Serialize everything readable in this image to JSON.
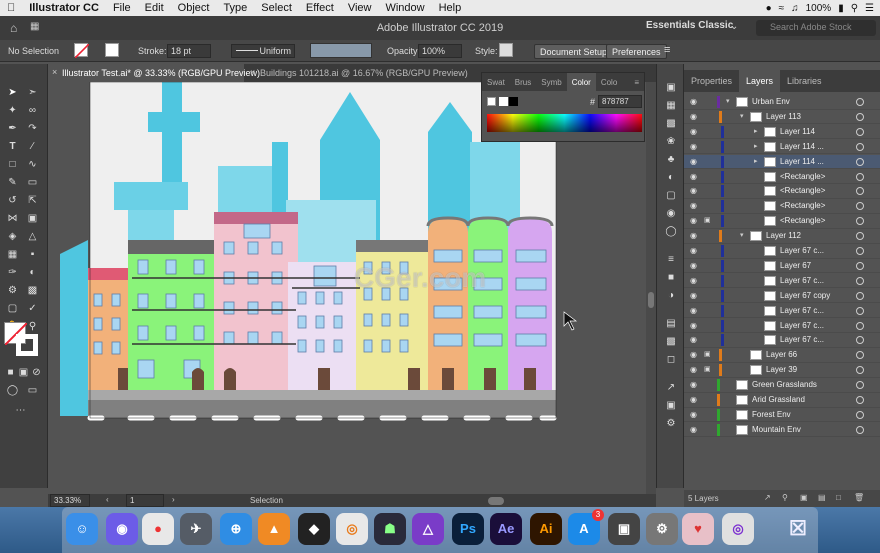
{
  "menubar": {
    "app": "Illustrator CC",
    "items": [
      "File",
      "Edit",
      "Object",
      "Type",
      "Select",
      "Effect",
      "View",
      "Window",
      "Help"
    ],
    "battery": "100%",
    "apple": ""
  },
  "appbar": {
    "title": "Adobe Illustrator CC 2019",
    "workspace": "Essentials Classic",
    "search_placeholder": "Search Adobe Stock"
  },
  "controlbar": {
    "selection": "No Selection",
    "stroke_label": "Stroke:",
    "stroke_value": "18 pt",
    "profile": "Uniform",
    "opacity_label": "Opacity:",
    "opacity_value": "100%",
    "style_label": "Style:",
    "doc_setup": "Document Setup",
    "preferences": "Preferences"
  },
  "tabs": [
    {
      "label": "Illustrator Test.ai* @ 33.33% (RGB/GPU Preview)"
    },
    {
      "label": "Buildings 101218.ai @ 16.67% (RGB/GPU Preview)"
    }
  ],
  "color_panel": {
    "tabs": [
      "Swat",
      "Brus",
      "Symb",
      "Color",
      "Colo"
    ],
    "hex": "878787"
  },
  "status": {
    "zoom": "33.33%",
    "artboard": "1",
    "mode": "Selection"
  },
  "layers_panel": {
    "tabs": [
      "Properties",
      "Layers",
      "Libraries"
    ],
    "count": "5 Layers",
    "rows": [
      {
        "name": "Urban Env",
        "indent": 0,
        "color": "#6a2ca0",
        "expanded": true
      },
      {
        "name": "Layer 113",
        "indent": 1,
        "color": "#e07b1a",
        "expanded": true
      },
      {
        "name": "Layer 114",
        "indent": 2,
        "color": "#1f2f9a",
        "expanded": false
      },
      {
        "name": "Layer 114 ...",
        "indent": 2,
        "color": "#1f2f9a",
        "expanded": false
      },
      {
        "name": "Layer 114 ...",
        "indent": 2,
        "color": "#1f2f9a",
        "expanded": false,
        "selected": true
      },
      {
        "name": "<Rectangle>",
        "indent": 2,
        "color": "#1f2f9a"
      },
      {
        "name": "<Rectangle>",
        "indent": 2,
        "color": "#1f2f9a"
      },
      {
        "name": "<Rectangle>",
        "indent": 2,
        "color": "#1f2f9a"
      },
      {
        "name": "<Rectangle>",
        "indent": 2,
        "color": "#1f2f9a",
        "locked": true
      },
      {
        "name": "Layer 112",
        "indent": 1,
        "color": "#e07b1a",
        "expanded": true
      },
      {
        "name": "Layer 67 c...",
        "indent": 2,
        "color": "#1f2f9a"
      },
      {
        "name": "Layer 67",
        "indent": 2,
        "color": "#1f2f9a"
      },
      {
        "name": "Layer 67 c...",
        "indent": 2,
        "color": "#1f2f9a"
      },
      {
        "name": "Layer 67 copy",
        "indent": 2,
        "color": "#1f2f9a"
      },
      {
        "name": "Layer 67 c...",
        "indent": 2,
        "color": "#1f2f9a"
      },
      {
        "name": "Layer 67 c...",
        "indent": 2,
        "color": "#1f2f9a"
      },
      {
        "name": "Layer 67 c...",
        "indent": 2,
        "color": "#1f2f9a"
      },
      {
        "name": "Layer 66",
        "indent": 1,
        "color": "#e07b1a",
        "locked": true
      },
      {
        "name": "Layer 39",
        "indent": 1,
        "color": "#e07b1a",
        "locked": true
      },
      {
        "name": "Green Grasslands",
        "indent": 0,
        "color": "#2fa82f"
      },
      {
        "name": "Arid Grassland",
        "indent": 0,
        "color": "#e07b1a"
      },
      {
        "name": "Forest Env",
        "indent": 0,
        "color": "#2fa82f"
      },
      {
        "name": "Mountain Env",
        "indent": 0,
        "color": "#2fa82f"
      }
    ]
  },
  "watermark": "CGer.com",
  "colors": {
    "accent": "#4b5a72",
    "sky_blue": "#4fc6e0",
    "building_green": "#8af37a",
    "building_pink": "#f2c3ce",
    "building_yellow": "#eee99a",
    "building_orange": "#f2b17a",
    "building_purple": "#d6a6f0"
  },
  "dock": [
    "Finder",
    "Siri",
    "Chrome",
    "Launchpad",
    "Safari",
    "VLC",
    "Unity",
    "Blender",
    "Cat",
    "Affinity",
    "Ps",
    "Ae",
    "Ai",
    "App Store",
    "Preview",
    "System Preferences",
    "Summer",
    "Screenshot",
    "Trash"
  ],
  "dock_badge": "3"
}
